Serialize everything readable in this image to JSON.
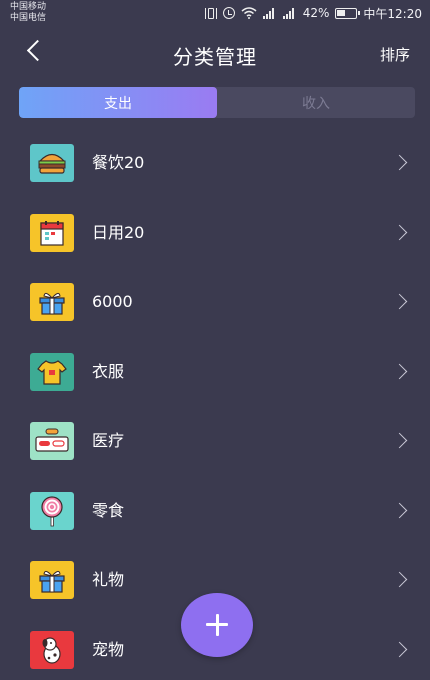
{
  "status_bar": {
    "carrier_1": "中国移动",
    "carrier_2": "中国电信",
    "battery": "42%",
    "time": "中午12:20",
    "icons": [
      "vibrate-icon",
      "alarm-icon",
      "wifi-icon",
      "signal-icon",
      "battery-icon"
    ]
  },
  "header": {
    "title": "分类管理",
    "sort_label": "排序",
    "back_icon": "back-arrow-icon"
  },
  "tabs": [
    {
      "label": "支出",
      "active": true
    },
    {
      "label": "收入",
      "active": false
    }
  ],
  "categories": [
    {
      "label": "餐饮20",
      "icon": "burger-icon",
      "icon_bg": "#5ec6c9"
    },
    {
      "label": "日用20",
      "icon": "calendar-icon",
      "icon_bg": "#f6c429"
    },
    {
      "label": "6000",
      "icon": "gift-box-icon",
      "icon_bg": "#f6c429"
    },
    {
      "label": "衣服",
      "icon": "jersey-icon",
      "icon_bg": "#3dab94"
    },
    {
      "label": "医疗",
      "icon": "pills-icon",
      "icon_bg": "#9ee2c6"
    },
    {
      "label": "零食",
      "icon": "lollipop-icon",
      "icon_bg": "#6ad4cd"
    },
    {
      "label": "礼物",
      "icon": "gift-box-icon",
      "icon_bg": "#f6c429"
    },
    {
      "label": "宠物",
      "icon": "dog-icon",
      "icon_bg": "#e9393e"
    }
  ],
  "fab": {
    "icon": "plus-icon"
  },
  "colors": {
    "background": "#3b3a4f",
    "tab_gradient_start": "#6fa4f7",
    "tab_gradient_end": "#9a7bf2",
    "fab": "#8e6ff0"
  }
}
